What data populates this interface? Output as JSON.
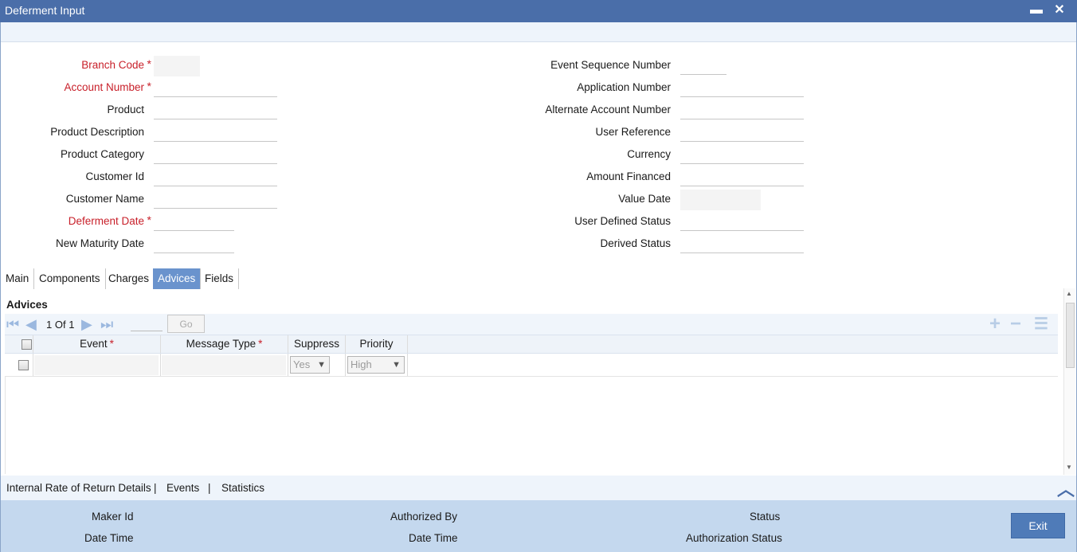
{
  "window": {
    "title": "Deferment Input",
    "minimize_glyph": "▬",
    "close_glyph": "✕"
  },
  "form_left": [
    {
      "label": "Branch Code",
      "required": "*"
    },
    {
      "label": "Account Number",
      "required": "*"
    },
    {
      "label": "Product"
    },
    {
      "label": "Product Description"
    },
    {
      "label": "Product Category"
    },
    {
      "label": "Customer Id"
    },
    {
      "label": "Customer Name"
    },
    {
      "label": "Deferment Date",
      "required": "*"
    },
    {
      "label": "New Maturity Date"
    }
  ],
  "form_right": [
    {
      "label": "Event Sequence Number"
    },
    {
      "label": "Application Number"
    },
    {
      "label": "Alternate Account Number"
    },
    {
      "label": "User Reference"
    },
    {
      "label": "Currency"
    },
    {
      "label": "Amount Financed"
    },
    {
      "label": "Value Date"
    },
    {
      "label": "User Defined Status"
    },
    {
      "label": "Derived Status"
    }
  ],
  "tabs": [
    "Main",
    "Components",
    "Charges",
    "Advices",
    "Fields"
  ],
  "active_tab": "Advices",
  "advices": {
    "title": "Advices",
    "pager": {
      "current": "1",
      "of_label": "Of",
      "total": "1"
    },
    "go_label": "Go",
    "columns": [
      {
        "label": "Event",
        "required": "*"
      },
      {
        "label": "Message Type",
        "required": "*"
      },
      {
        "label": "Suppress"
      },
      {
        "label": "Priority"
      }
    ],
    "row": {
      "suppress": "Yes",
      "priority": "High"
    }
  },
  "links": [
    "Internal Rate of Return Details",
    "Events",
    "Statistics"
  ],
  "link_separator": "|",
  "footer": {
    "maker_id": "Maker Id",
    "date_time_1": "Date Time",
    "authorized_by": "Authorized By",
    "date_time_2": "Date Time",
    "status": "Status",
    "authorization_status": "Authorization Status",
    "exit_label": "Exit"
  },
  "colors": {
    "titlebar": "#4a6ea9",
    "required": "#c8202a",
    "active_tab": "#6a93cd",
    "footer": "#c4d8ee",
    "exit_button": "#4f7bb8"
  }
}
